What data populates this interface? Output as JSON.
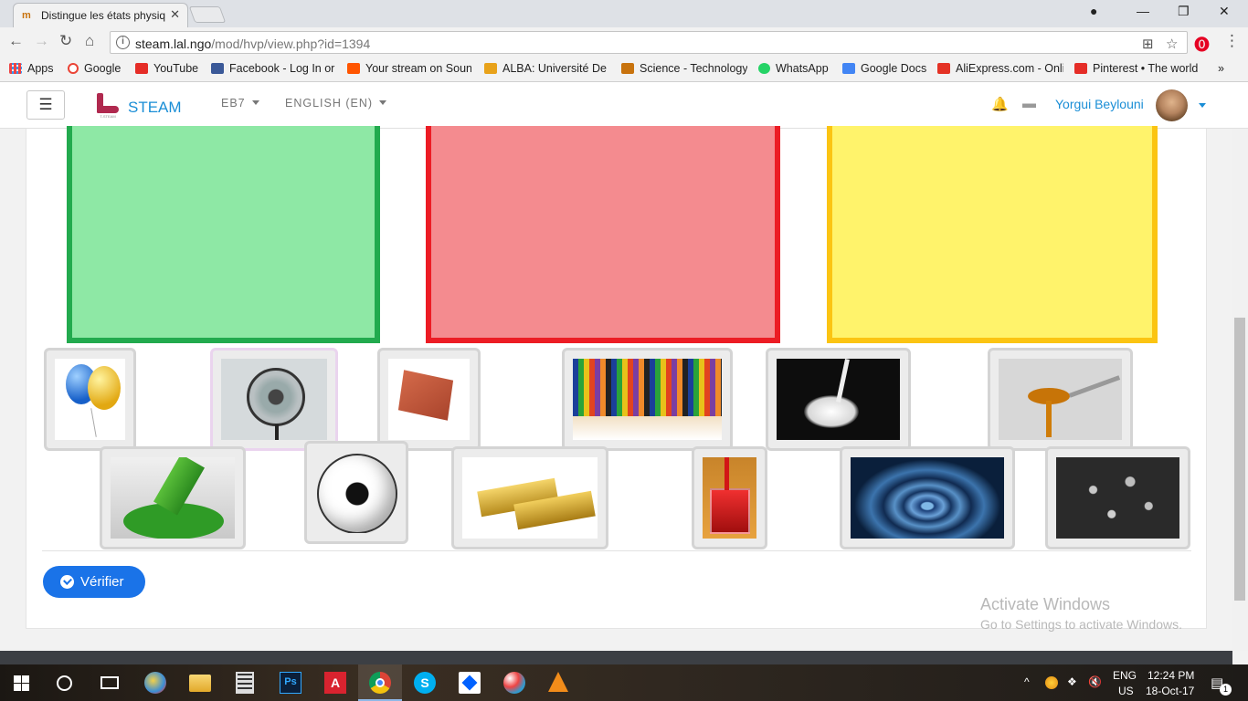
{
  "browser": {
    "tab_title": "Distingue les états physiq",
    "tab_favicon": "m",
    "url_host": "steam.lal.ngo",
    "url_path": "/mod/hvp/view.php?id=1394"
  },
  "bookmarks": [
    {
      "label": "Apps",
      "color": "#4285f4"
    },
    {
      "label": "Google",
      "color": "#ea4335"
    },
    {
      "label": "YouTube",
      "color": "#e52d27"
    },
    {
      "label": "Facebook - Log In or",
      "color": "#3b5998"
    },
    {
      "label": "Your stream on Sound",
      "color": "#ff5500"
    },
    {
      "label": "ALBA: Université De B",
      "color": "#e8a21a"
    },
    {
      "label": "Science - Technology",
      "color": "#c8730e"
    },
    {
      "label": "WhatsApp",
      "color": "#25d366"
    },
    {
      "label": "Google Docs",
      "color": "#4285f4"
    },
    {
      "label": "AliExpress.com - Onli",
      "color": "#e43225"
    },
    {
      "label": "Pinterest • The world",
      "color": "#e52d27"
    }
  ],
  "navbar": {
    "menu_label": "☰",
    "brand": "STEAM",
    "logo_text": "T-STEAM",
    "course": "EB7",
    "language": "ENGLISH (EN)",
    "user_name": "Yorgui Beylouni"
  },
  "activity": {
    "drop_zones": [
      {
        "name": "drop-zone-green",
        "fill": "#8ee8a5",
        "border": "#22aa4e"
      },
      {
        "name": "drop-zone-red",
        "fill": "#f48b8f",
        "border": "#ec1c24"
      },
      {
        "name": "drop-zone-yellow",
        "fill": "#fff36b",
        "border": "#fbc412"
      }
    ],
    "items": [
      {
        "name": "balloons"
      },
      {
        "name": "fan"
      },
      {
        "name": "brick"
      },
      {
        "name": "colored-pencils"
      },
      {
        "name": "milk-splash"
      },
      {
        "name": "honey-spoon"
      },
      {
        "name": "green-paint"
      },
      {
        "name": "soccer-ball"
      },
      {
        "name": "gold-bars"
      },
      {
        "name": "red-drink-glass"
      },
      {
        "name": "water-drop"
      },
      {
        "name": "screws-nuts"
      }
    ],
    "check_button": "Vérifier"
  },
  "watermark": {
    "line1": "Activate Windows",
    "line2": "Go to Settings to activate Windows."
  },
  "taskbar": {
    "language": "ENG",
    "region": "US",
    "time": "12:24 PM",
    "date": "18-Oct-17",
    "notifications": "1"
  }
}
